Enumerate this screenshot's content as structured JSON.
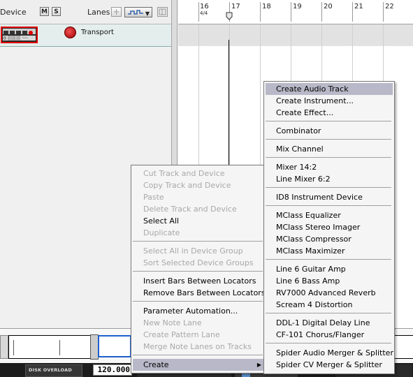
{
  "track_header": {
    "device_label": "Device",
    "mute_label": "M",
    "solo_label": "S",
    "lanes_label": "Lanes",
    "add_lane_label": "+"
  },
  "transport_track": {
    "name": "Transport",
    "device_icon": "transport-device-icon"
  },
  "ruler": {
    "bars": [
      "16",
      "17",
      "18",
      "19",
      "20",
      "21",
      "22"
    ],
    "signature": "4/4"
  },
  "transport_bar": {
    "disk_overload_label": "DISK OVERLOAD",
    "tempo": "120.000"
  },
  "context_menu": {
    "items": [
      {
        "label": "Cut Track and Device",
        "enabled": false
      },
      {
        "label": "Copy Track and Device",
        "enabled": false
      },
      {
        "label": "Paste",
        "enabled": false
      },
      {
        "label": "Delete Track and Device",
        "enabled": false
      },
      {
        "label": "Select All",
        "enabled": true
      },
      {
        "label": "Duplicate",
        "enabled": false
      },
      {
        "label": "Select All in Device Group",
        "enabled": false
      },
      {
        "label": "Sort Selected Device Groups",
        "enabled": false
      },
      {
        "label": "Insert Bars Between Locators",
        "enabled": true
      },
      {
        "label": "Remove Bars Between Locators",
        "enabled": true
      },
      {
        "label": "Parameter Automation...",
        "enabled": true
      },
      {
        "label": "New Note Lane",
        "enabled": false
      },
      {
        "label": "Create Pattern Lane",
        "enabled": false
      },
      {
        "label": "Merge Note Lanes on Tracks",
        "enabled": false
      },
      {
        "label": "Create",
        "enabled": true,
        "submenu": true
      }
    ]
  },
  "create_submenu": {
    "items": [
      "Create Audio Track",
      "Create Instrument...",
      "Create Effect...",
      "Combinator",
      "Mix Channel",
      "Mixer 14:2",
      "Line Mixer 6:2",
      "ID8 Instrument Device",
      "MClass Equalizer",
      "MClass Stereo Imager",
      "MClass Compressor",
      "MClass Maximizer",
      "Line 6 Guitar Amp",
      "Line 6 Bass Amp",
      "RV7000 Advanced Reverb",
      "Scream 4 Distortion",
      "DDL-1 Digital Delay Line",
      "CF-101 Chorus/Flanger",
      "Spider Audio Merger & Splitter",
      "Spider CV Merger & Splitter"
    ],
    "highlighted": "Create Audio Track"
  },
  "colors": {
    "menu_highlight": "#b8b8c8",
    "disabled_text": "#a8a8a8",
    "transport_red": "#e00000"
  }
}
